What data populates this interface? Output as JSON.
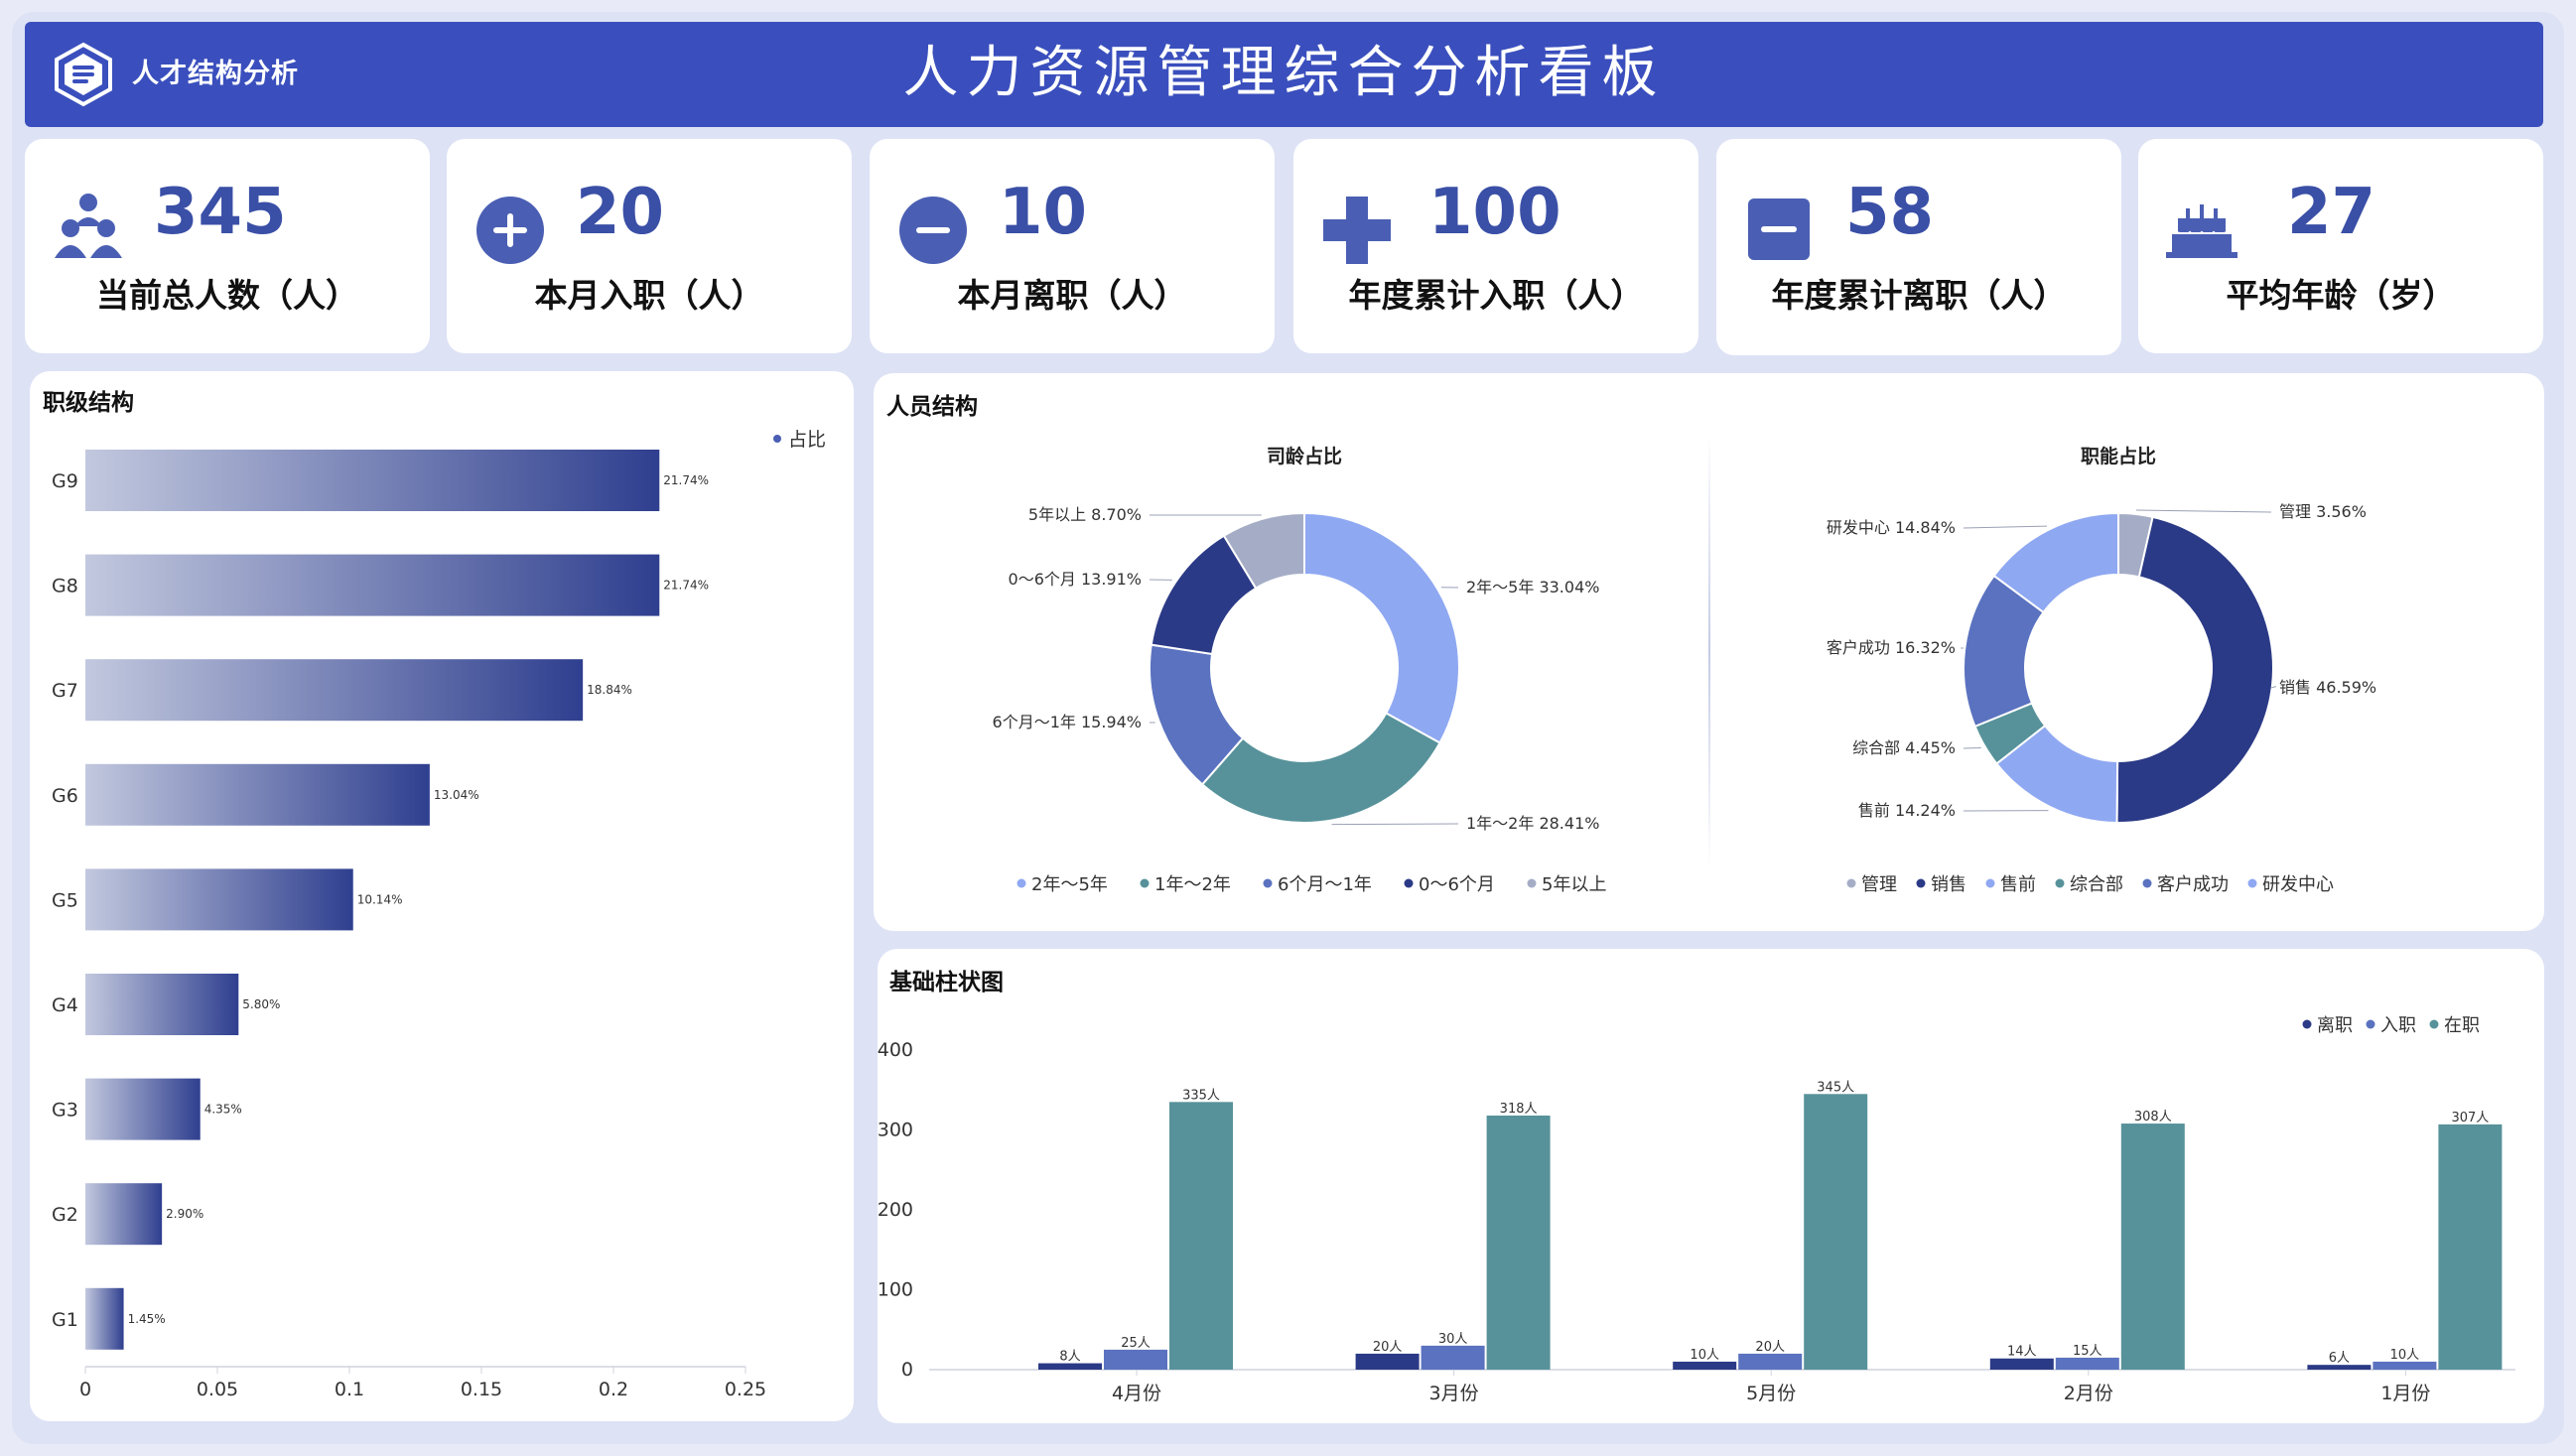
{
  "header": {
    "brand": "人才结构分析",
    "title": "人力资源管理综合分析看板"
  },
  "kpis": [
    {
      "value": "345",
      "label": "当前总人数（人）",
      "icon": "people-group-icon"
    },
    {
      "value": "20",
      "label": "本月入职（人）",
      "icon": "plus-circle-icon"
    },
    {
      "value": "10",
      "label": "本月离职（人）",
      "icon": "minus-circle-icon"
    },
    {
      "value": "100",
      "label": "年度累计入职（人）",
      "icon": "plus-cross-icon"
    },
    {
      "value": "58",
      "label": "年度累计离职（人）",
      "icon": "minus-square-icon"
    },
    {
      "value": "27",
      "label": "平均年龄（岁）",
      "icon": "birthday-cake-icon"
    }
  ],
  "colors": {
    "header_bg": "#3a4fbd",
    "kpi_value": "#3a4fa6",
    "bar_start": "#c2c8de",
    "bar_end": "#2f3f8f",
    "teal": "#57929a",
    "light_blue": "#8fa8f2",
    "mid_blue": "#5a72bf",
    "navy": "#2b3a86",
    "grey_blue": "#a5adc6"
  },
  "panels": {
    "level": "职级结构",
    "people": "人员结构",
    "basic_bar": "基础柱状图"
  },
  "chart_data": [
    {
      "type": "bar",
      "orientation": "horizontal",
      "title": "职级结构",
      "legend": [
        "占比"
      ],
      "legend_position": "top-right",
      "categories": [
        "G9",
        "G8",
        "G7",
        "G6",
        "G5",
        "G4",
        "G3",
        "G2",
        "G1"
      ],
      "values": [
        0.2174,
        0.2174,
        0.1884,
        0.1304,
        0.1014,
        0.058,
        0.0435,
        0.029,
        0.0145
      ],
      "labels": [
        "21.74%",
        "21.74%",
        "18.84%",
        "13.04%",
        "10.14%",
        "5.80%",
        "4.35%",
        "2.90%",
        "1.45%"
      ],
      "xlim": [
        0,
        0.25
      ],
      "xticks": [
        "0",
        "0.05",
        "0.1",
        "0.15",
        "0.2",
        "0.25"
      ]
    },
    {
      "type": "pie",
      "donut": true,
      "title": "司龄占比",
      "slices": [
        {
          "name": "2年～5年",
          "value": 33.04,
          "label": "2年～5年 33.04%",
          "color": "#8fa8f2"
        },
        {
          "name": "1年～2年",
          "value": 28.41,
          "label": "1年～2年 28.41%",
          "color": "#57929a"
        },
        {
          "name": "6个月～1年",
          "value": 15.94,
          "label": "6个月～1年 15.94%",
          "color": "#5a72bf"
        },
        {
          "name": "0～6个月",
          "value": 13.91,
          "label": "0～6个月 13.91%",
          "color": "#2b3a86"
        },
        {
          "name": "5年以上",
          "value": 8.7,
          "label": "5年以上 8.70%",
          "color": "#a5adc6"
        }
      ],
      "legend_position": "bottom"
    },
    {
      "type": "pie",
      "donut": true,
      "title": "职能占比",
      "slices": [
        {
          "name": "管理",
          "value": 3.56,
          "label": "管理 3.56%",
          "color": "#a5adc6"
        },
        {
          "name": "销售",
          "value": 46.59,
          "label": "销售 46.59%",
          "color": "#2b3a86"
        },
        {
          "name": "售前",
          "value": 14.24,
          "label": "售前 14.24%",
          "color": "#8fa8f2"
        },
        {
          "name": "综合部",
          "value": 4.45,
          "label": "综合部 4.45%",
          "color": "#57929a"
        },
        {
          "name": "客户成功",
          "value": 16.32,
          "label": "客户成功 16.32%",
          "color": "#5a72bf"
        },
        {
          "name": "研发中心",
          "value": 14.84,
          "label": "研发中心 14.84%",
          "color": "#8fa8f2"
        }
      ],
      "legend_position": "bottom"
    },
    {
      "type": "bar",
      "title": "基础柱状图",
      "categories": [
        "4月份",
        "3月份",
        "5月份",
        "2月份",
        "1月份"
      ],
      "series": [
        {
          "name": "离职",
          "values": [
            8,
            20,
            10,
            14,
            6
          ],
          "labels": [
            "8人",
            "20人",
            "10人",
            "14人",
            "6人"
          ],
          "color": "#2b3a86"
        },
        {
          "name": "入职",
          "values": [
            25,
            30,
            20,
            15,
            10
          ],
          "labels": [
            "25人",
            "30人",
            "20人",
            "15人",
            "10人"
          ],
          "color": "#5a72bf"
        },
        {
          "name": "在职",
          "values": [
            335,
            318,
            345,
            308,
            307
          ],
          "labels": [
            "335人",
            "318人",
            "345人",
            "308人",
            "307人"
          ],
          "color": "#57929a"
        }
      ],
      "ylim": [
        0,
        400
      ],
      "yticks": [
        "0",
        "100",
        "200",
        "300",
        "400"
      ],
      "legend_position": "top-right"
    }
  ]
}
